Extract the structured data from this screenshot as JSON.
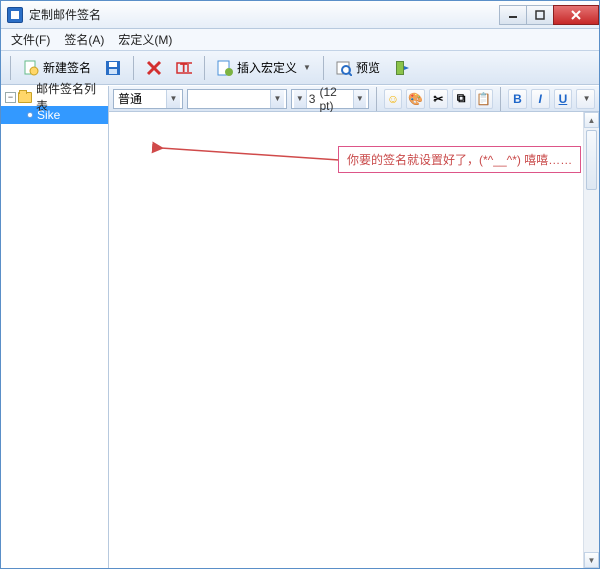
{
  "window": {
    "title": "定制邮件签名"
  },
  "menus": {
    "file": "文件(F)",
    "signature": "签名(A)",
    "macro": "宏定义(M)"
  },
  "toolbar": {
    "new_sig": "新建签名",
    "insert_macro": "插入宏定义",
    "preview": "预览"
  },
  "tree": {
    "root_label": "邮件签名列表",
    "items": [
      {
        "label": "Sike"
      }
    ]
  },
  "editor": {
    "style_combo": "普通",
    "font_combo": "",
    "size_value": "3",
    "size_label": "(12 pt)",
    "annotation": "你要的签名就设置好了，(*^__^*) 嘻嘻……"
  }
}
